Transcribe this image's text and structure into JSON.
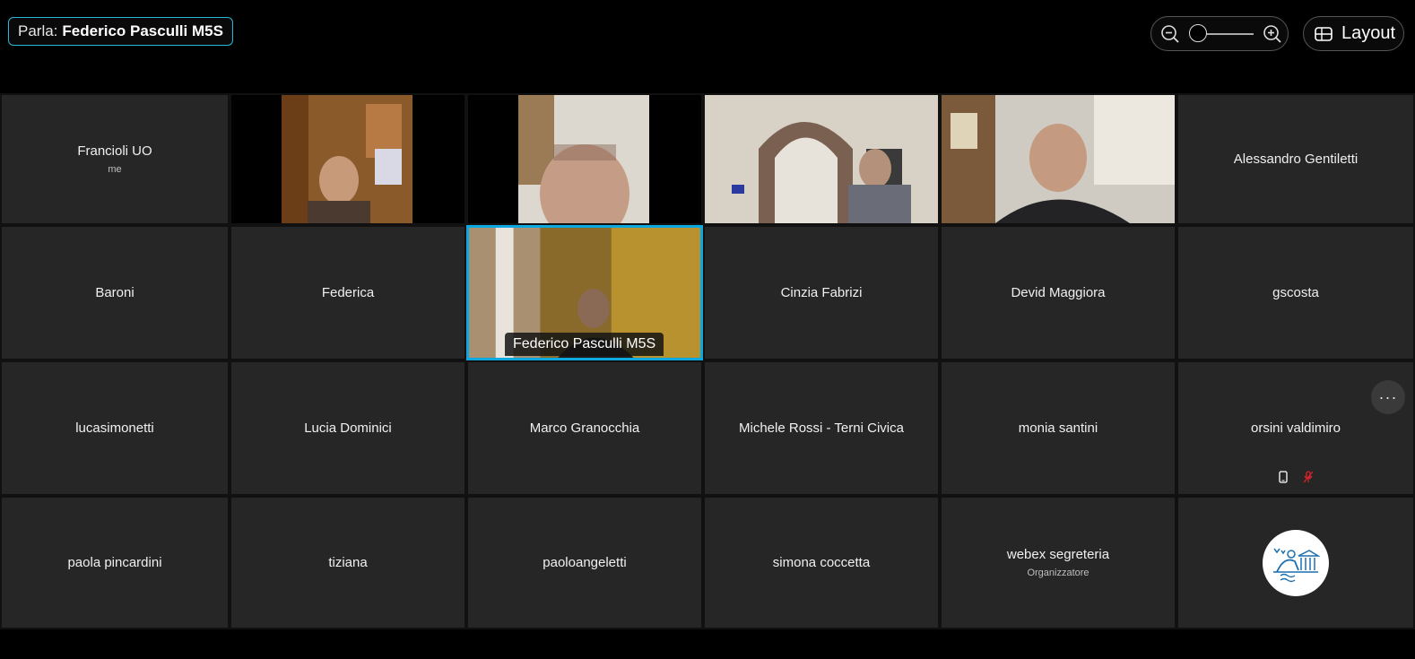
{
  "speaking": {
    "label": "Parla:",
    "name": "Federico Pasculli M5S"
  },
  "toolbar": {
    "zoom_out_icon": "zoom-out-icon",
    "zoom_in_icon": "zoom-in-icon",
    "zoom_level": 0,
    "layout_label": "Layout"
  },
  "participants": [
    {
      "name": "Francioli UO",
      "sub": "me"
    },
    {
      "name": "",
      "video": true
    },
    {
      "name": "",
      "video": true
    },
    {
      "name": "",
      "video": true
    },
    {
      "name": "",
      "video": true
    },
    {
      "name": "Alessandro Gentiletti"
    },
    {
      "name": "Baroni"
    },
    {
      "name": "Federica"
    },
    {
      "name": "Federico Pasculli M5S",
      "video": true,
      "active": true
    },
    {
      "name": "Cinzia Fabrizi"
    },
    {
      "name": "Devid Maggiora"
    },
    {
      "name": "gscosta"
    },
    {
      "name": "lucasimonetti"
    },
    {
      "name": "Lucia Dominici"
    },
    {
      "name": "Marco Granocchia"
    },
    {
      "name": "Michele Rossi - Terni Civica"
    },
    {
      "name": "monia santini"
    },
    {
      "name": "orsini valdimiro",
      "icons": [
        "phone-icon",
        "muted-mic-icon"
      ]
    },
    {
      "name": "paola pincardini"
    },
    {
      "name": "tiziana"
    },
    {
      "name": "paoloangeletti"
    },
    {
      "name": "simona coccetta"
    },
    {
      "name": "webex segreteria",
      "sub": "Organizzatore"
    },
    {
      "name": "",
      "logo": "organization-logo"
    }
  ],
  "more_icon": "more-options-icon",
  "colors": {
    "accent": "#0ea8e0",
    "tile": "#262626",
    "muted": "#d9232d"
  }
}
